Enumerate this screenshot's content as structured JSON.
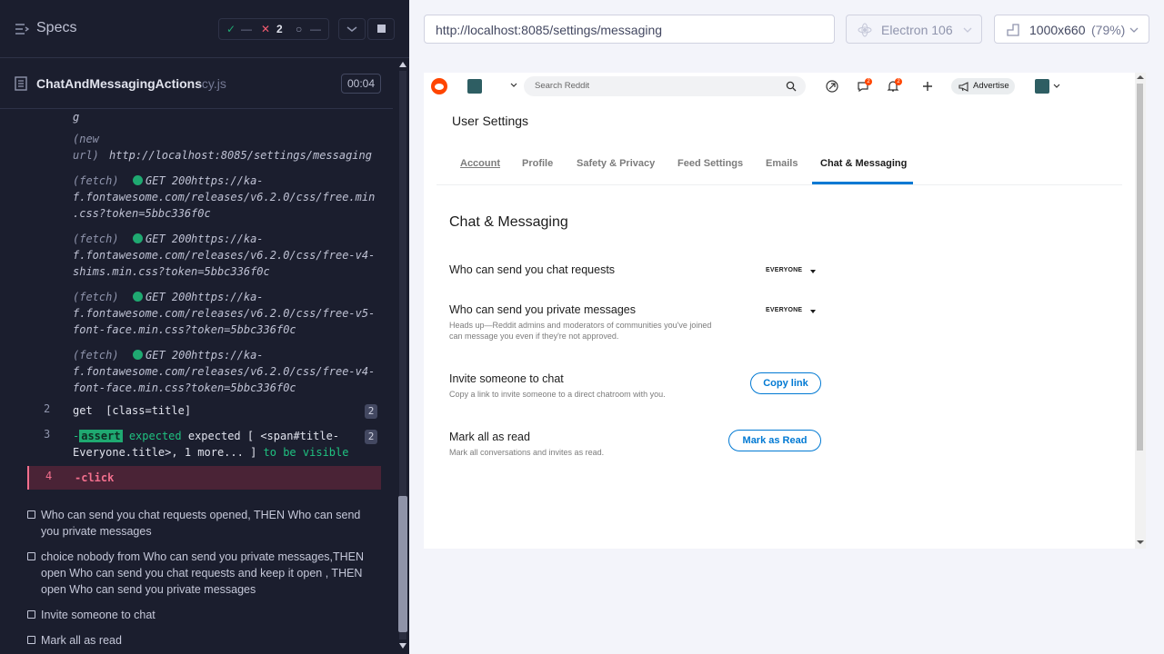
{
  "runner": {
    "specs_label": "Specs",
    "passed_count": "—",
    "failed_count": "2",
    "pending_count": "—",
    "spec_name": "ChatAndMessagingActions",
    "spec_ext": ".cy.js",
    "timer": "00:04"
  },
  "log": {
    "truncated_line": "g",
    "new_url_label": "(new\nurl)",
    "new_url": "http://localhost:8085/settings/messaging",
    "fetches": [
      {
        "label": "(fetch)",
        "method": "GET 200",
        "url": "https://ka-\nf.fontawesome.com/releases/v6.2.0/css/free.min\n.css?token=5bbc336f0c"
      },
      {
        "label": "(fetch)",
        "method": "GET 200",
        "url": "https://ka-\nf.fontawesome.com/releases/v6.2.0/css/free-v4-\nshims.min.css?token=5bbc336f0c"
      },
      {
        "label": "(fetch)",
        "method": "GET 200",
        "url": "https://ka-\nf.fontawesome.com/releases/v6.2.0/css/free-v5-\nfont-face.min.css?token=5bbc336f0c"
      },
      {
        "label": "(fetch)",
        "method": "GET 200",
        "url": "https://ka-\nf.fontawesome.com/releases/v6.2.0/css/free-v4-\nfont-face.min.css?token=5bbc336f0c"
      }
    ],
    "commands": [
      {
        "num": "2",
        "text": "get  [class=title]",
        "badge": "2"
      },
      {
        "num": "3",
        "assert": "assert",
        "pre": "-",
        "text1": " expected [ <span#title-",
        "text2": "Everyone.title>, 1 more... ]",
        "tobe": "to be",
        "visible": "visible",
        "badge": "2"
      },
      {
        "num": "4",
        "text": "-click"
      }
    ]
  },
  "tests": [
    "Who can send you chat requests opened, THEN Who can send you private messages",
    "choice nobody from Who can send you private messages,THEN open Who can send you chat requests and keep it open , THEN open Who can send you private messages",
    "Invite someone to chat",
    "Mark all as read"
  ],
  "browser": {
    "url": "http://localhost:8085/settings/messaging",
    "engine": "Electron 106",
    "viewport": "1000x660",
    "zoom": "(79%)"
  },
  "reddit": {
    "search_placeholder": "Search Reddit",
    "chat_badge": "2",
    "notif_badge": "2",
    "advertise": "Advertise",
    "page_title": "User Settings",
    "tabs": [
      "Account",
      "Profile",
      "Safety & Privacy",
      "Feed Settings",
      "Emails",
      "Chat & Messaging"
    ],
    "section_title": "Chat & Messaging",
    "settings": {
      "chat_requests": {
        "title": "Who can send you chat requests",
        "value": "EVERYONE"
      },
      "private_messages": {
        "title": "Who can send you private messages",
        "desc": "Heads up—Reddit admins and moderators of communities you've joined can message you even if they're not approved.",
        "value": "EVERYONE"
      },
      "invite": {
        "title": "Invite someone to chat",
        "desc": "Copy a link to invite someone to a direct chatroom with you.",
        "button": "Copy link"
      },
      "mark_read": {
        "title": "Mark all as read",
        "desc": "Mark all conversations and invites as read.",
        "button": "Mark as Read"
      }
    }
  }
}
